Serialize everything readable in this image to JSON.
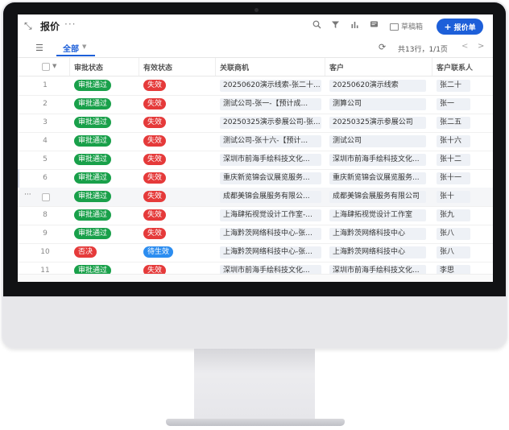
{
  "toolbar": {
    "title": "报价",
    "more": "···",
    "draft_label": "草稿箱",
    "new_button_label": "报价单"
  },
  "tabbar": {
    "tab_all": "全部",
    "count_text": "共13行，1/1页"
  },
  "table": {
    "headers": [
      "审批状态",
      "有效状态",
      "关联商机",
      "客户",
      "客户联系人"
    ],
    "rows": [
      {
        "num": "1",
        "approval": "审批通过",
        "validity": "失效",
        "opportunity": "20250620演示线索-张二十...",
        "customer": "20250620演示线索",
        "contact": "张二十"
      },
      {
        "num": "2",
        "approval": "审批通过",
        "validity": "失效",
        "opportunity": "测试公司-张一-【预计成...",
        "customer": "测算公司",
        "contact": "张一"
      },
      {
        "num": "3",
        "approval": "审批通过",
        "validity": "失效",
        "opportunity": "20250325演示参展公司-张...",
        "customer": "20250325演示参展公司",
        "contact": "张二五"
      },
      {
        "num": "4",
        "approval": "审批通过",
        "validity": "失效",
        "opportunity": "测试公司-张十六-【预计...",
        "customer": "测试公司",
        "contact": "张十六"
      },
      {
        "num": "5",
        "approval": "审批通过",
        "validity": "失效",
        "opportunity": "深圳市前海手绘科技文化...",
        "customer": "深圳市前海手绘科技文化...",
        "contact": "张十二"
      },
      {
        "num": "6",
        "approval": "审批通过",
        "validity": "失效",
        "opportunity": "重庆新览锦会议展览服务...",
        "customer": "重庆新览锦会议展览服务...",
        "contact": "张十一"
      },
      {
        "num": "",
        "approval": "审批通过",
        "validity": "失效",
        "opportunity": "成都美锦会展服务有限公...",
        "customer": "成都美锦会展服务有限公司",
        "contact": "张十"
      },
      {
        "num": "8",
        "approval": "审批通过",
        "validity": "失效",
        "opportunity": "上海肆拓视觉设计工作室-...",
        "customer": "上海肆拓视觉设计工作室",
        "contact": "张九"
      },
      {
        "num": "9",
        "approval": "审批通过",
        "validity": "失效",
        "opportunity": "上海黔茨网络科技中心-张...",
        "customer": "上海黔茨网络科技中心",
        "contact": "张八"
      },
      {
        "num": "10",
        "approval": "否决",
        "validity": "待生效",
        "opportunity": "上海黔茨网络科技中心-张...",
        "customer": "上海黔茨网络科技中心",
        "contact": "张八"
      },
      {
        "num": "11",
        "approval": "审批通过",
        "validity": "失效",
        "opportunity": "深圳市前海手绘科技文化...",
        "customer": "深圳市前海手绘科技文化...",
        "contact": "李思"
      }
    ]
  },
  "colors": {
    "accent": "#1d5fd9",
    "approved": "#19a04a",
    "invalid": "#e53a3a",
    "pending": "#2c8df0"
  }
}
